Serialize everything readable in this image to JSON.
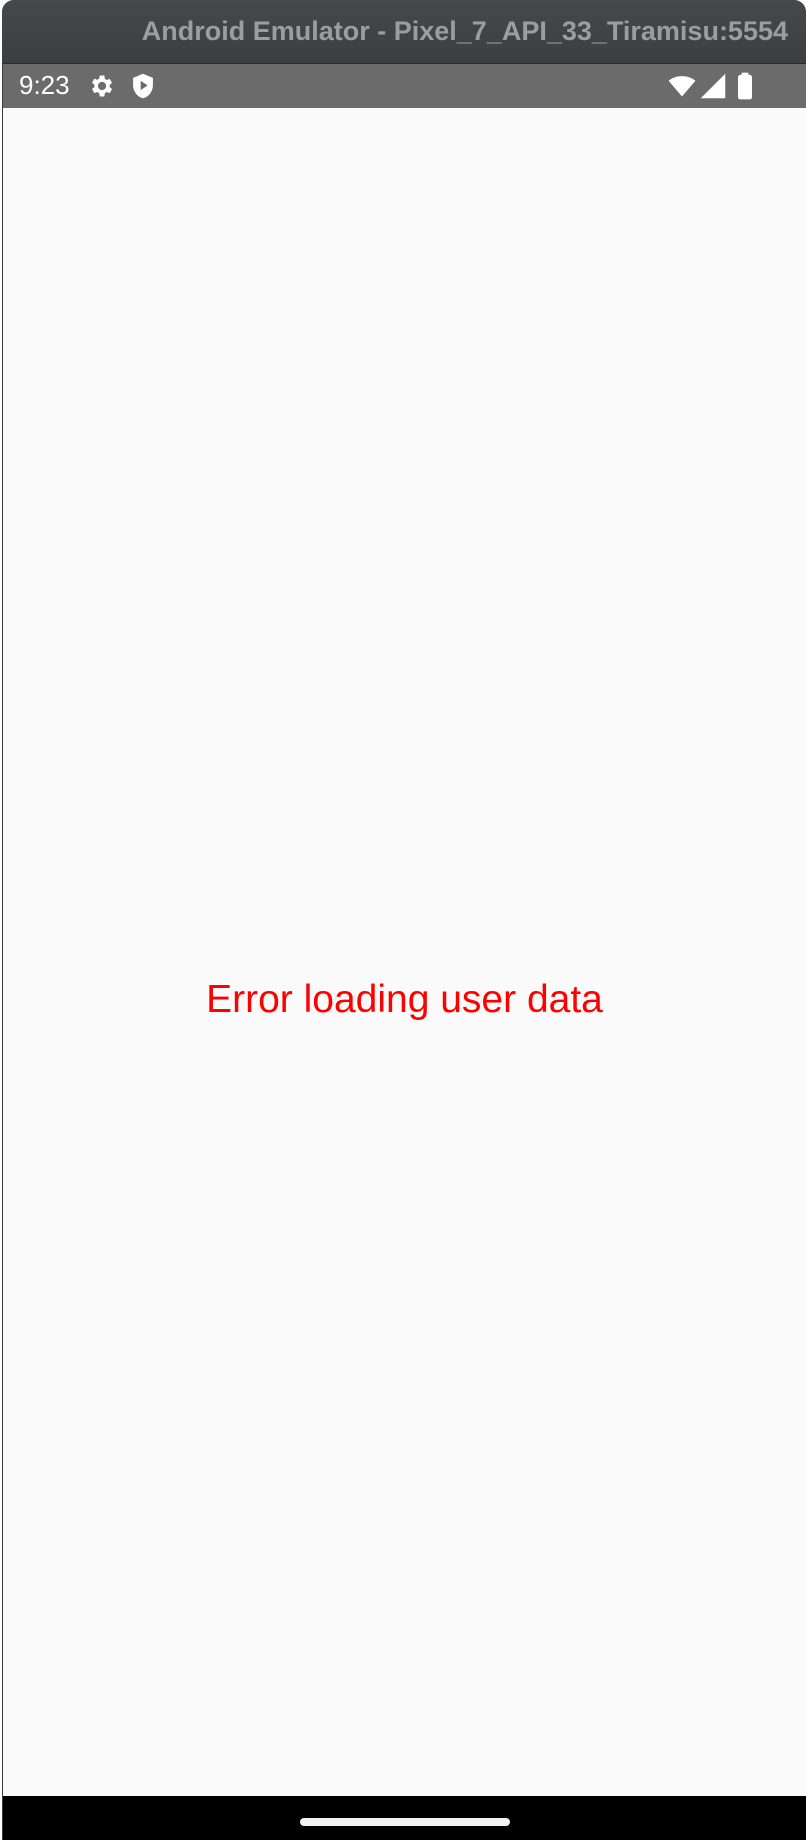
{
  "window": {
    "title": "Android Emulator - Pixel_7_API_33_Tiramisu:5554"
  },
  "status_bar": {
    "time": "9:23",
    "left_icons": [
      "gear-icon",
      "shield-play-icon"
    ],
    "right_icons": [
      "wifi-icon",
      "cell-signal-icon",
      "battery-icon"
    ]
  },
  "main": {
    "error_message": "Error loading user data",
    "error_color": "#ff0000"
  },
  "colors": {
    "background": "#fafafa",
    "status_bar": "#6b6b6b",
    "nav_bar": "#000000"
  }
}
